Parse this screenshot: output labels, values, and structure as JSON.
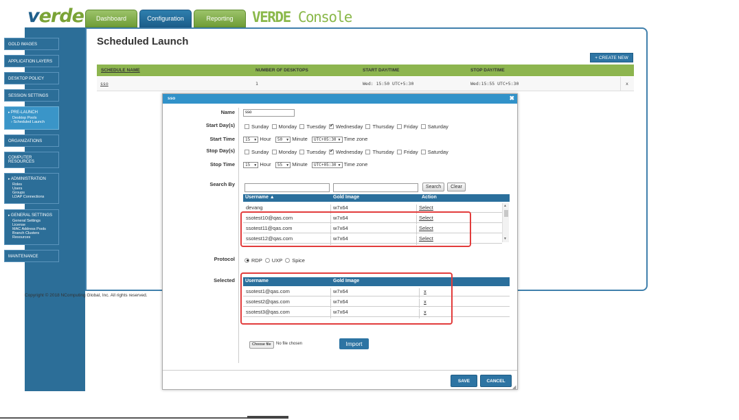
{
  "header": {
    "logo_v": "v",
    "logo_rest": "erde",
    "tabs": [
      "Dashboard",
      "Configuration",
      "Reporting"
    ],
    "console_title_a": "VERDE",
    "console_title_b": " Console"
  },
  "sidebar": {
    "items": [
      {
        "label": "GOLD IMAGES"
      },
      {
        "label": "APPLICATION LAYERS"
      },
      {
        "label": "DESKTOP POLICY"
      },
      {
        "label": "SESSION SETTINGS"
      },
      {
        "label": "PRE-LAUNCH",
        "sub": [
          "Desktop Pools",
          "Scheduled Launch"
        ]
      },
      {
        "label": "ORGANIZATIONS"
      },
      {
        "label": "COMPUTER RESOURCES"
      },
      {
        "label": "ADMINISTRATION",
        "sub": [
          "Roles",
          "Users",
          "Groups",
          "LDAP Connections"
        ]
      },
      {
        "label": "GENERAL SETTINGS",
        "sub": [
          "General Settings",
          "License",
          "MAC Address Pools",
          "Branch Clusters",
          "Resources"
        ]
      },
      {
        "label": "MAINTENANCE"
      }
    ]
  },
  "copyright": "Copyright © 2018 NComputing Global, Inc. All rights reserved.",
  "page": {
    "title": "Scheduled Launch",
    "create_new": "+ CREATE NEW",
    "columns": [
      "SCHEDULE NAME",
      "NUMBER OF DESKTOPS",
      "START DAY/TIME",
      "STOP DAY/TIME"
    ],
    "row": {
      "name": "sso",
      "desktops": "1",
      "start": "Wed: 15:50 UTC+5:30",
      "stop": "Wed:15:55 UTC+5:30",
      "delete": "x"
    }
  },
  "modal": {
    "title": "sso",
    "close": "✖",
    "labels": {
      "name": "Name",
      "start_days": "Start Day(s)",
      "start_time": "Start Time",
      "stop_days": "Stop Day(s)",
      "stop_time": "Stop Time",
      "search_by": "Search By",
      "protocol": "Protocol",
      "selected": "Selected"
    },
    "name_value": "sso",
    "days": [
      "Sunday",
      "Monday",
      "Tuesday",
      "Wednesday",
      "Thursday",
      "Friday",
      "Saturday"
    ],
    "start_time": {
      "hour": "15",
      "hour_label": "Hour",
      "minute": "50",
      "minute_label": "Minute",
      "tz": "UTC+05:30",
      "tz_label": "Time zone"
    },
    "stop_time": {
      "hour": "15",
      "hour_label": "Hour",
      "minute": "55",
      "minute_label": "Minute",
      "tz": "UTC+05:30",
      "tz_label": "Time zone"
    },
    "search_button": "Search",
    "clear_button": "Clear",
    "search_grid": {
      "columns": [
        "Username ▲",
        "Gold Image",
        "Action"
      ],
      "rows": [
        {
          "user": "devang",
          "image": "w7x64",
          "action": "Select"
        },
        {
          "user": "ssotest10@qas.com",
          "image": "w7x64",
          "action": "Select"
        },
        {
          "user": "ssotest11@qas.com",
          "image": "w7x64",
          "action": "Select"
        },
        {
          "user": "ssotest12@qas.com",
          "image": "w7x64",
          "action": "Select"
        }
      ]
    },
    "protocols": [
      "RDP",
      "UXP",
      "Spice"
    ],
    "selected_grid": {
      "columns": [
        "Username",
        "Gold Image",
        ""
      ],
      "rows": [
        {
          "user": "ssotest1@qas.com",
          "image": "w7x64",
          "action": "x"
        },
        {
          "user": "ssotest2@qas.com",
          "image": "w7x64",
          "action": "x"
        },
        {
          "user": "ssotest3@qas.com",
          "image": "w7x64",
          "action": "x"
        }
      ]
    },
    "choose_file": "Choose file",
    "no_file": "No file chosen",
    "import": "Import",
    "save": "SAVE",
    "cancel": "CANCEL"
  },
  "colors": {
    "accent_blue": "#2d74a3",
    "green": "#8db54f",
    "highlight_red": "#e23b3b"
  }
}
